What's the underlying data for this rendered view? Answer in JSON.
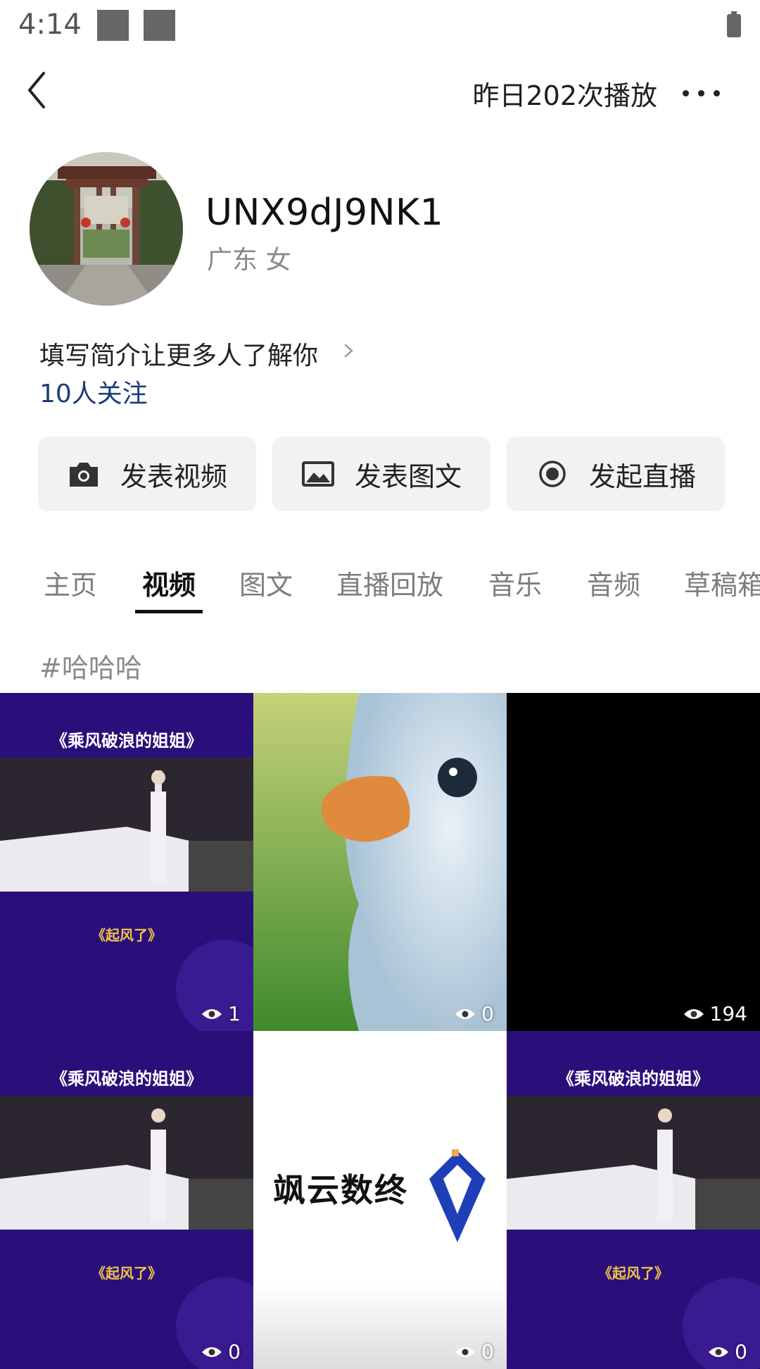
{
  "status_bar": {
    "time": "4:14"
  },
  "topbar": {
    "plays_yesterday": "昨日202次播放"
  },
  "profile": {
    "username": "UNX9dJ9NK1",
    "location_gender": "广东 女",
    "bio_prompt": "填写简介让更多人了解你",
    "followers": "10人关注"
  },
  "actions": [
    {
      "label": "发表视频",
      "icon": "camera-icon"
    },
    {
      "label": "发表图文",
      "icon": "image-icon"
    },
    {
      "label": "发起直播",
      "icon": "live-icon"
    }
  ],
  "tabs": [
    "主页",
    "视频",
    "图文",
    "直播回放",
    "音乐",
    "音频",
    "草稿箱"
  ],
  "active_tab": "视频",
  "hashtag": "#哈哈哈",
  "videos": [
    {
      "views": "1",
      "thumb_title": "《乘风破浪的姐姐》",
      "thumb_caption": "《起风了》"
    },
    {
      "views": "0"
    },
    {
      "views": "194"
    },
    {
      "views": "0",
      "thumb_title": "《乘风破浪的姐姐》",
      "thumb_caption": "《起风了》"
    },
    {
      "views": "0",
      "thumb_logo_text": "飒云数终"
    },
    {
      "views": "0",
      "thumb_title": "《乘风破浪的姐姐》",
      "thumb_caption": "《起风了》"
    }
  ]
}
